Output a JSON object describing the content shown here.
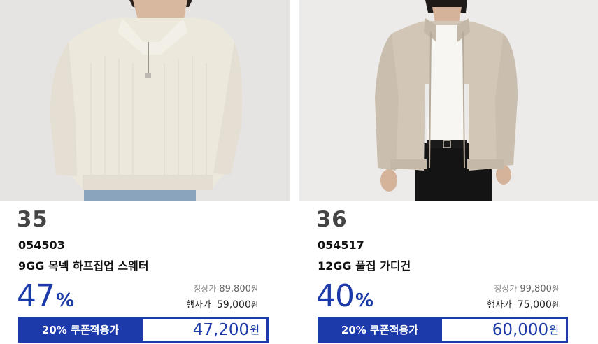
{
  "products": [
    {
      "rank": "35",
      "code": "054503",
      "name": "9GG 목넥 하프집업 스웨터",
      "discount": "47",
      "discount_unit": "%",
      "regular_label": "정상가",
      "regular_price": "89,800",
      "event_label": "행사가",
      "event_price": "59,000",
      "coupon_label": "20% 쿠폰적용가",
      "coupon_price": "47,200",
      "currency": "원",
      "image_icon": "half-zip-sweater-model-image"
    },
    {
      "rank": "36",
      "code": "054517",
      "name": "12GG 풀집 가디건",
      "discount": "40",
      "discount_unit": "%",
      "regular_label": "정상가",
      "regular_price": "99,800",
      "event_label": "행사가",
      "event_price": "75,000",
      "coupon_label": "20% 쿠폰적용가",
      "coupon_price": "60,000",
      "currency": "원",
      "image_icon": "full-zip-cardigan-model-image"
    }
  ],
  "colors": {
    "accent": "#1c3aa9",
    "photo_bg": "#e6e4e3",
    "sweater": "#ece8dc",
    "cardigan": "#d2c7b7"
  }
}
